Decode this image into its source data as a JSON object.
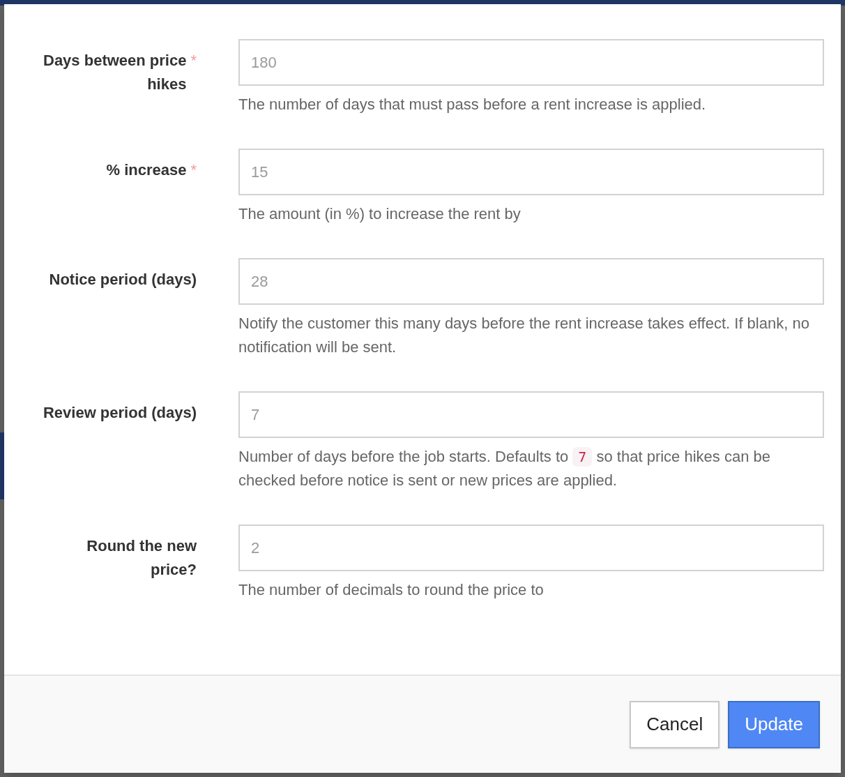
{
  "fields": [
    {
      "label": "Days between price hikes",
      "required_mark": "*",
      "placeholder": "180",
      "help": [
        {
          "kind": "text",
          "text": "The number of days that must pass before a rent increase is applied."
        }
      ]
    },
    {
      "label": "% increase",
      "required_mark": "*",
      "placeholder": "15",
      "help": [
        {
          "kind": "text",
          "text": "The amount (in %) to increase the rent by"
        }
      ]
    },
    {
      "label": "Notice period (days)",
      "placeholder": "28",
      "help": [
        {
          "kind": "text",
          "text": "Notify the customer this many days before the rent increase takes effect. If blank, no notification will be sent."
        }
      ]
    },
    {
      "label": "Review period (days)",
      "placeholder": "7",
      "help": [
        {
          "kind": "text",
          "text": "Number of days before the job starts. Defaults to "
        },
        {
          "kind": "code",
          "text": "7"
        },
        {
          "kind": "text",
          "text": " so that price hikes can be checked before notice is sent or new prices are applied."
        }
      ]
    },
    {
      "label": "Round the new price?",
      "placeholder": "2",
      "help": [
        {
          "kind": "text",
          "text": "The number of decimals to round the price to"
        }
      ]
    }
  ],
  "buttons": [
    {
      "label": "Cancel",
      "kind": "secondary"
    },
    {
      "label": "Update",
      "kind": "primary"
    }
  ]
}
